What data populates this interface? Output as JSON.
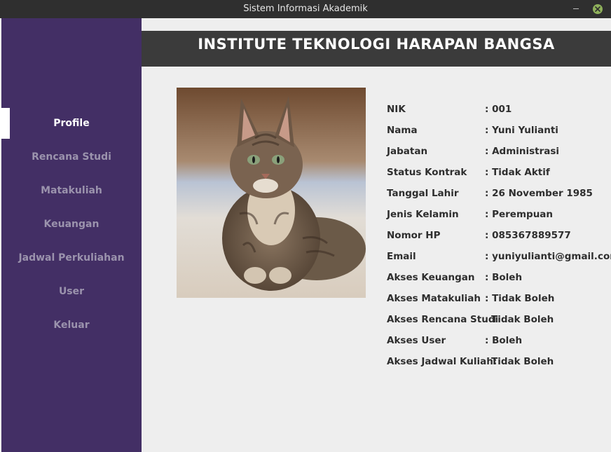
{
  "window": {
    "title": "Sistem Informasi Akademik",
    "close_color": "#8fb15b"
  },
  "sidebar": {
    "background": "#432f65",
    "items": [
      {
        "label": "Profile",
        "active": true
      },
      {
        "label": "Rencana Studi",
        "active": false
      },
      {
        "label": "Matakuliah",
        "active": false
      },
      {
        "label": "Keuangan",
        "active": false
      },
      {
        "label": "Jadwal Perkuliahan",
        "active": false
      },
      {
        "label": "User",
        "active": false
      },
      {
        "label": "Keluar",
        "active": false
      }
    ]
  },
  "header": {
    "title": "INSTITUTE TEKNOLOGI HARAPAN BANGSA"
  },
  "profile": {
    "photo_icon": "cat-photo",
    "fields": [
      {
        "label": "NIK",
        "value": ": 001"
      },
      {
        "label": "Nama",
        "value": ":  Yuni Yulianti"
      },
      {
        "label": "Jabatan",
        "value": ": Administrasi"
      },
      {
        "label": "Status Kontrak",
        "value": ": Tidak Aktif"
      },
      {
        "label": "Tanggal Lahir",
        "value": ": 26 November 1985"
      },
      {
        "label": "Jenis Kelamin",
        "value": ": Perempuan"
      },
      {
        "label": "Nomor HP",
        "value": ": 085367889577"
      },
      {
        "label": "Email",
        "value": ": yuniyulianti@gmail.com"
      },
      {
        "label": "Akses Keuangan",
        "value": ": Boleh"
      },
      {
        "label": "Akses Matakuliah",
        "value": ": Tidak Boleh"
      },
      {
        "label": "Akses Rencana Studi",
        "value": "Tidak Boleh"
      },
      {
        "label": "Akses User",
        "value": ": Boleh"
      },
      {
        "label": "Akses Jadwal Kuliah:",
        "value": "Tidak Boleh"
      }
    ]
  }
}
